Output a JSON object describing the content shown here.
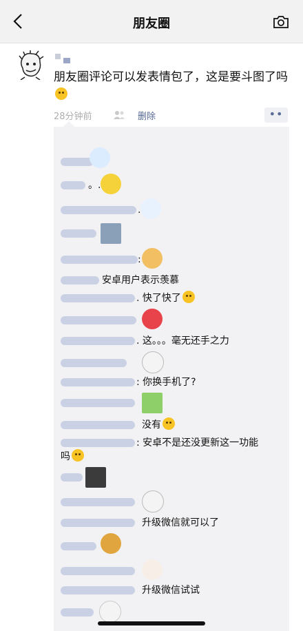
{
  "nav": {
    "title": "朋友圈",
    "back_icon": "chevron-left-icon",
    "camera_icon": "camera-icon"
  },
  "post": {
    "text": "朋友圈评论可以发表情包了，这是要斗图了吗",
    "time": "28分钟前",
    "delete_label": "删除",
    "more_label": "••"
  },
  "comments": [
    {
      "text": ""
    },
    {
      "text": "。."
    },
    {
      "text": "."
    },
    {
      "text": ""
    },
    {
      "text": ":"
    },
    {
      "text": "安卓用户表示羡慕"
    },
    {
      "text": ". 快了快了"
    },
    {
      "text": ""
    },
    {
      "text": ". 这。。。毫无还手之力"
    },
    {
      "text": ""
    },
    {
      "text": ": 你换手机了?"
    },
    {
      "text": ""
    },
    {
      "text": "没有"
    },
    {
      "text": ": 安卓不是还没更新这一功能"
    },
    {
      "text": "吗"
    },
    {
      "text": ""
    },
    {
      "text": ""
    },
    {
      "text": "升级微信就可以了"
    },
    {
      "text": ""
    },
    {
      "text": ""
    },
    {
      "text": "升级微信试试"
    },
    {
      "text": ""
    }
  ]
}
